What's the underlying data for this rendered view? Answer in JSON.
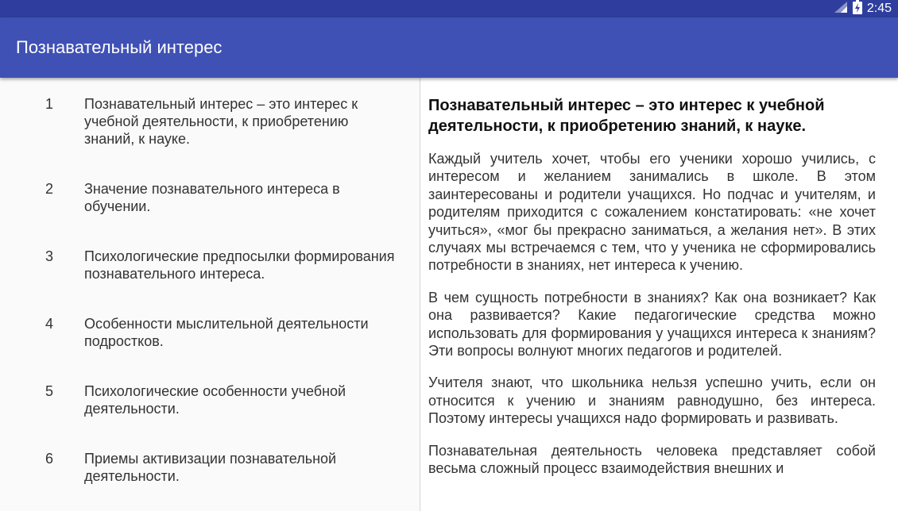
{
  "status_bar": {
    "time": "2:45",
    "icons": [
      "signal-icon",
      "battery-charging-icon"
    ]
  },
  "app_bar": {
    "title": "Познавательный интерес"
  },
  "list": {
    "items": [
      {
        "number": "1",
        "text": "Познавательный интерес – это интерес к учебной деятельности, к приобретению знаний, к науке."
      },
      {
        "number": "2",
        "text": "Значение познавательного интереса в обучении."
      },
      {
        "number": "3",
        "text": "Психологические предпосылки формирования познавательного интереса."
      },
      {
        "number": "4",
        "text": "Особенности мыслительной деятельности подростков."
      },
      {
        "number": "5",
        "text": "Психологические особенности учебной деятельности."
      },
      {
        "number": "6",
        "text": "Приемы активизации познавательной деятельности."
      }
    ]
  },
  "content": {
    "heading": "Познавательный интерес – это интерес к учебной деятельности, к приобретению знаний, к науке.",
    "paragraphs": [
      "Каждый учитель хочет, чтобы его ученики хорошо учились, с интересом и желанием занимались в школе. В этом заинтересованы и родители учащихся. Но подчас и учителям, и родителям приходится с сожалением констатировать: «не хочет учиться», «мог бы прекрасно заниматься, а желания нет». В этих случаях мы встречаемся с тем, что у ученика не сформировались потребности в знаниях, нет интереса к учению.",
      "В чем сущность потребности в знаниях? Как она возникает? Как она развивается? Какие педагогические средства можно использовать для формирования у учащихся интереса к знаниям? Эти вопросы волнуют многих педагогов и родителей.",
      "Учителя знают, что школьника нельзя успешно учить, если он относится к учению и знаниям равнодушно, без интереса. Поэтому интересы учащихся надо формировать и развивать.",
      "Познавательная деятельность человека представляет собой весьма сложный процесс взаимодействия внешних и"
    ]
  }
}
